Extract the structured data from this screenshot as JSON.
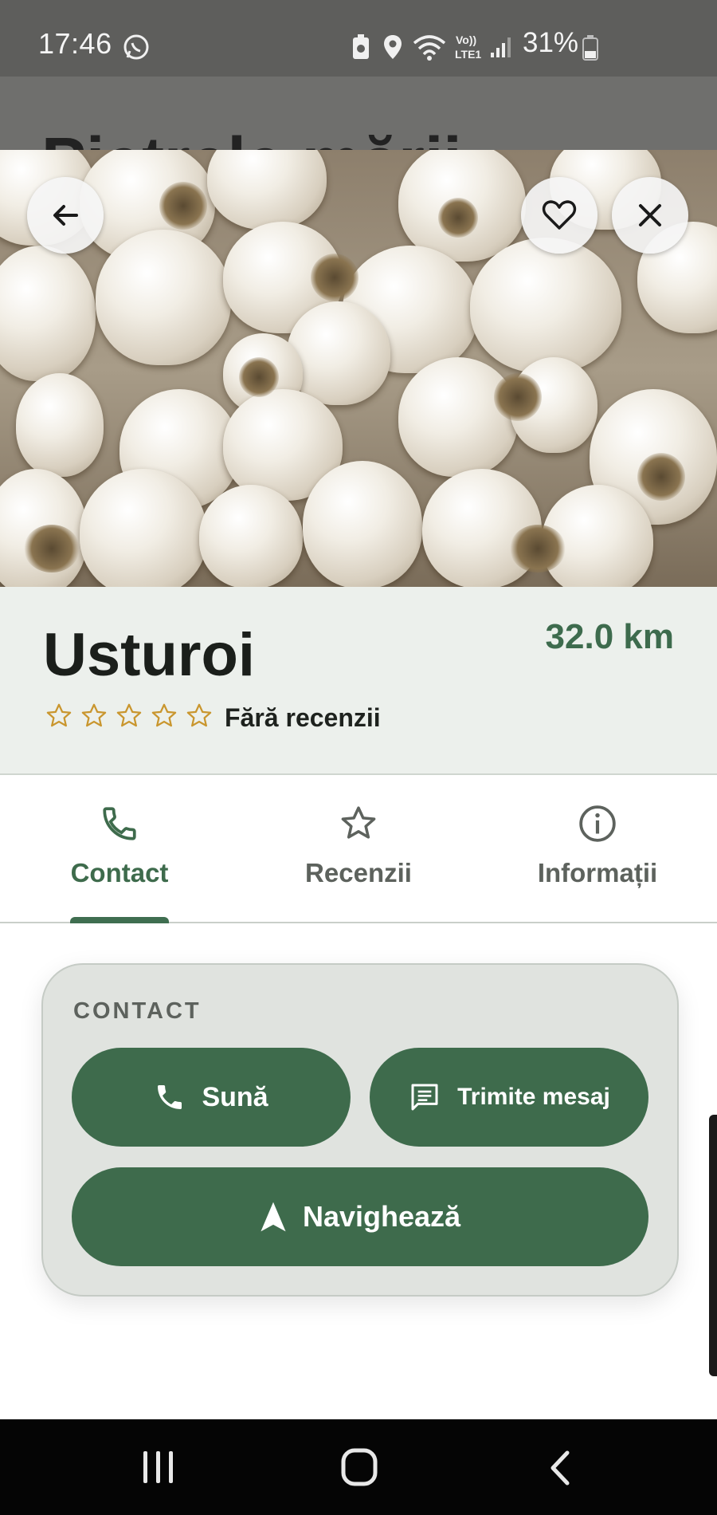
{
  "status_bar": {
    "time": "17:46",
    "battery": "31%",
    "icons": [
      "whatsapp-icon",
      "battery-saver-icon",
      "location-icon",
      "wifi-icon",
      "volte-icon",
      "signal-icon",
      "battery-icon"
    ]
  },
  "background_page": {
    "title": "Pietrele mării"
  },
  "hero": {
    "image_alt": "garlic bulbs",
    "back_icon": "arrow-left-icon",
    "favorite_icon": "heart-icon",
    "close_icon": "close-icon"
  },
  "product": {
    "name": "Usturoi",
    "distance": "32.0 km",
    "rating_stars": 0,
    "rating_max": 5,
    "rating_text": "Fără recenzii"
  },
  "tabs": [
    {
      "label": "Contact",
      "icon": "phone-icon",
      "active": true
    },
    {
      "label": "Recenzii",
      "icon": "star-icon",
      "active": false
    },
    {
      "label": "Informații",
      "icon": "info-icon",
      "active": false
    }
  ],
  "contact": {
    "heading": "CONTACT",
    "call_label": "Sună",
    "message_label": "Trimite mesaj",
    "navigate_label": "Navighează"
  },
  "colors": {
    "accent": "#3e6b4c",
    "star": "#c9962e",
    "tab_inactive": "#5d625d"
  }
}
